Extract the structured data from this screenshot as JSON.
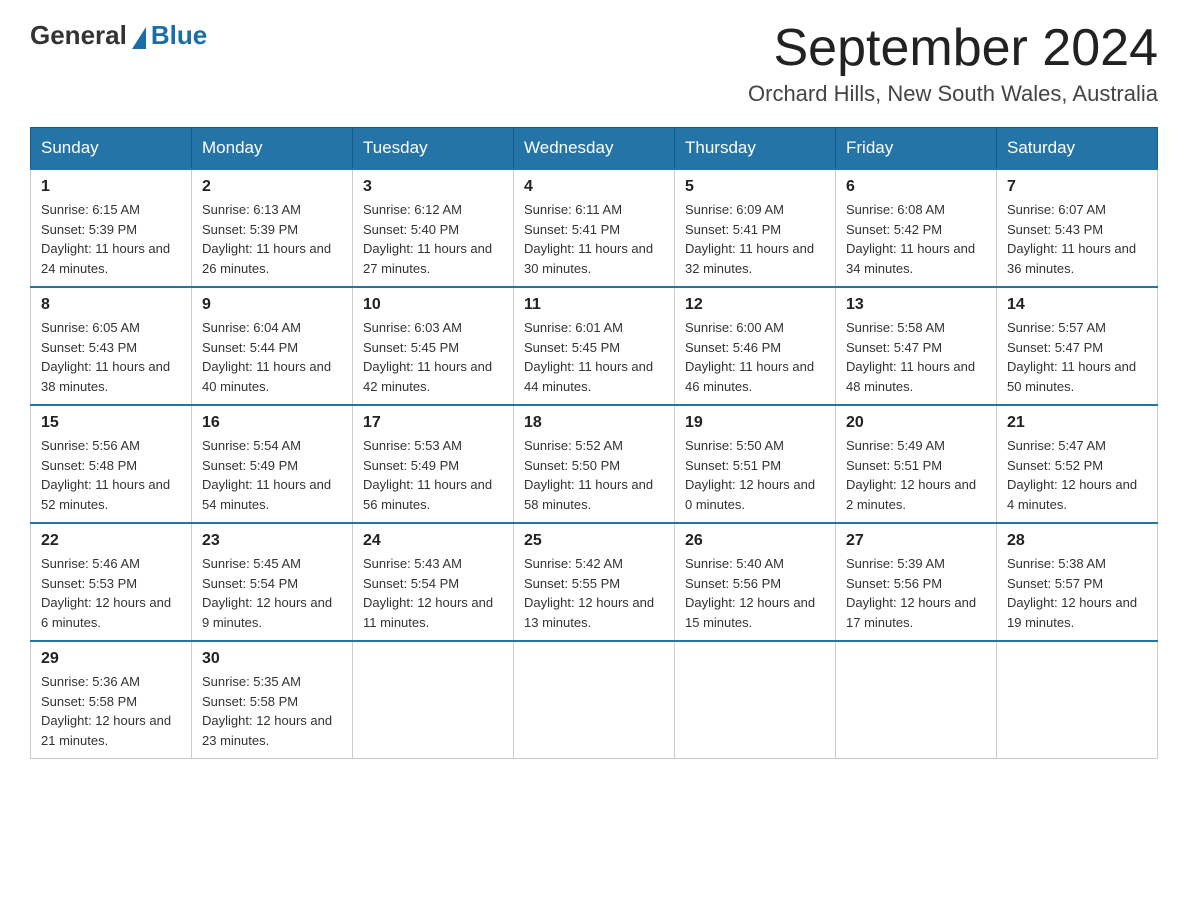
{
  "header": {
    "logo_general": "General",
    "logo_blue": "Blue",
    "title": "September 2024",
    "subtitle": "Orchard Hills, New South Wales, Australia"
  },
  "days_of_week": [
    "Sunday",
    "Monday",
    "Tuesday",
    "Wednesday",
    "Thursday",
    "Friday",
    "Saturday"
  ],
  "weeks": [
    [
      {
        "day": "1",
        "sunrise": "6:15 AM",
        "sunset": "5:39 PM",
        "daylight": "11 hours and 24 minutes."
      },
      {
        "day": "2",
        "sunrise": "6:13 AM",
        "sunset": "5:39 PM",
        "daylight": "11 hours and 26 minutes."
      },
      {
        "day": "3",
        "sunrise": "6:12 AM",
        "sunset": "5:40 PM",
        "daylight": "11 hours and 27 minutes."
      },
      {
        "day": "4",
        "sunrise": "6:11 AM",
        "sunset": "5:41 PM",
        "daylight": "11 hours and 30 minutes."
      },
      {
        "day": "5",
        "sunrise": "6:09 AM",
        "sunset": "5:41 PM",
        "daylight": "11 hours and 32 minutes."
      },
      {
        "day": "6",
        "sunrise": "6:08 AM",
        "sunset": "5:42 PM",
        "daylight": "11 hours and 34 minutes."
      },
      {
        "day": "7",
        "sunrise": "6:07 AM",
        "sunset": "5:43 PM",
        "daylight": "11 hours and 36 minutes."
      }
    ],
    [
      {
        "day": "8",
        "sunrise": "6:05 AM",
        "sunset": "5:43 PM",
        "daylight": "11 hours and 38 minutes."
      },
      {
        "day": "9",
        "sunrise": "6:04 AM",
        "sunset": "5:44 PM",
        "daylight": "11 hours and 40 minutes."
      },
      {
        "day": "10",
        "sunrise": "6:03 AM",
        "sunset": "5:45 PM",
        "daylight": "11 hours and 42 minutes."
      },
      {
        "day": "11",
        "sunrise": "6:01 AM",
        "sunset": "5:45 PM",
        "daylight": "11 hours and 44 minutes."
      },
      {
        "day": "12",
        "sunrise": "6:00 AM",
        "sunset": "5:46 PM",
        "daylight": "11 hours and 46 minutes."
      },
      {
        "day": "13",
        "sunrise": "5:58 AM",
        "sunset": "5:47 PM",
        "daylight": "11 hours and 48 minutes."
      },
      {
        "day": "14",
        "sunrise": "5:57 AM",
        "sunset": "5:47 PM",
        "daylight": "11 hours and 50 minutes."
      }
    ],
    [
      {
        "day": "15",
        "sunrise": "5:56 AM",
        "sunset": "5:48 PM",
        "daylight": "11 hours and 52 minutes."
      },
      {
        "day": "16",
        "sunrise": "5:54 AM",
        "sunset": "5:49 PM",
        "daylight": "11 hours and 54 minutes."
      },
      {
        "day": "17",
        "sunrise": "5:53 AM",
        "sunset": "5:49 PM",
        "daylight": "11 hours and 56 minutes."
      },
      {
        "day": "18",
        "sunrise": "5:52 AM",
        "sunset": "5:50 PM",
        "daylight": "11 hours and 58 minutes."
      },
      {
        "day": "19",
        "sunrise": "5:50 AM",
        "sunset": "5:51 PM",
        "daylight": "12 hours and 0 minutes."
      },
      {
        "day": "20",
        "sunrise": "5:49 AM",
        "sunset": "5:51 PM",
        "daylight": "12 hours and 2 minutes."
      },
      {
        "day": "21",
        "sunrise": "5:47 AM",
        "sunset": "5:52 PM",
        "daylight": "12 hours and 4 minutes."
      }
    ],
    [
      {
        "day": "22",
        "sunrise": "5:46 AM",
        "sunset": "5:53 PM",
        "daylight": "12 hours and 6 minutes."
      },
      {
        "day": "23",
        "sunrise": "5:45 AM",
        "sunset": "5:54 PM",
        "daylight": "12 hours and 9 minutes."
      },
      {
        "day": "24",
        "sunrise": "5:43 AM",
        "sunset": "5:54 PM",
        "daylight": "12 hours and 11 minutes."
      },
      {
        "day": "25",
        "sunrise": "5:42 AM",
        "sunset": "5:55 PM",
        "daylight": "12 hours and 13 minutes."
      },
      {
        "day": "26",
        "sunrise": "5:40 AM",
        "sunset": "5:56 PM",
        "daylight": "12 hours and 15 minutes."
      },
      {
        "day": "27",
        "sunrise": "5:39 AM",
        "sunset": "5:56 PM",
        "daylight": "12 hours and 17 minutes."
      },
      {
        "day": "28",
        "sunrise": "5:38 AM",
        "sunset": "5:57 PM",
        "daylight": "12 hours and 19 minutes."
      }
    ],
    [
      {
        "day": "29",
        "sunrise": "5:36 AM",
        "sunset": "5:58 PM",
        "daylight": "12 hours and 21 minutes."
      },
      {
        "day": "30",
        "sunrise": "5:35 AM",
        "sunset": "5:58 PM",
        "daylight": "12 hours and 23 minutes."
      },
      null,
      null,
      null,
      null,
      null
    ]
  ]
}
